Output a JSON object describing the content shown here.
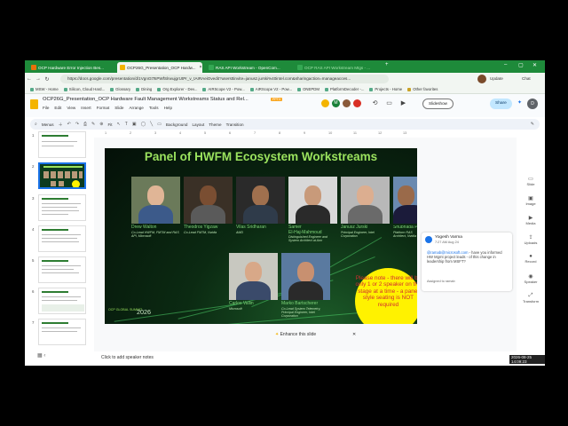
{
  "browser": {
    "tabs": [
      {
        "label": "OCP Hardware Error Injection Bes...",
        "color": "#e8710a"
      },
      {
        "label": "OCP26G_Presentation_OCP Hardw...",
        "color": "#f4b400"
      },
      {
        "label": "RAS API Workstream - OpenCom...",
        "color": "#34a853"
      },
      {
        "label": "OCP RAS API Workstream Mtgs - ...",
        "color": "#34a853"
      }
    ],
    "new_tab": "+",
    "url": "https://docs.google.com/presentation/d/1VgnGtTsPWfSlrwujgrUtPr_v_tAIRAeiOvedit?usersttinvite=janusz.jurski%40intel.com&sharingaction=manageacces...",
    "update_label": "Update",
    "chat_label": "Chat",
    "bookmarks": [
      "MSW - Home",
      "Silicon, Cloud Hard...",
      "Glossary",
      "Dining",
      "Org Explorer - Dev...",
      "AIRScope V2 - Pow...",
      "AIRScope V2 - Pow...",
      "ONEPDM",
      "PlatformDecoder -...",
      "Projects - Home",
      "Other favorites"
    ]
  },
  "docs": {
    "title": "OCP26G_Presentation_OCP Hardware Fault Management Workstreams Status and Rel...",
    "file_badge": "PPTX",
    "menu": [
      "File",
      "Edit",
      "View",
      "Insert",
      "Format",
      "Slide",
      "Arrange",
      "Tools",
      "Help"
    ],
    "slideshow_label": "Slideshow",
    "share_label": "Share",
    "user_initial": "D",
    "avatar_letter": "M"
  },
  "toolbar": {
    "menus_label": "Menus",
    "zoom_label": "Fit",
    "background_label": "Background",
    "layout_label": "Layout",
    "theme_label": "Theme",
    "transition_label": "Transition"
  },
  "ruler": [
    "1",
    "2",
    "3",
    "4",
    "5",
    "6",
    "7",
    "8",
    "9",
    "10",
    "11",
    "12",
    "13"
  ],
  "filmstrip": {
    "numbers": [
      "1",
      "2",
      "3",
      "4",
      "5",
      "6",
      "7"
    ],
    "selected_index": 2
  },
  "slide": {
    "title": "Panel of HWFM Ecosystem Workstreams",
    "people": [
      {
        "name": "Drew Walton",
        "role": "Co-Lead HWFM, FMTM and RAS API, Microsoft",
        "skin": "#e0b596",
        "shirt": "#3c5a8a",
        "bg": "#6b7a5a"
      },
      {
        "name": "Theodros Yigzaw",
        "role": "Co-Lead FMTM, Nvidia",
        "skin": "#7a4e32",
        "shirt": "#5a5a5a",
        "bg": "#3a3026"
      },
      {
        "name": "Vilas Sridharan",
        "role": "AMD",
        "skin": "#a0704e",
        "shirt": "#2f3b4a",
        "bg": "#2a2a2a"
      },
      {
        "name": "Samer\nEl-Haj-Mahmoud",
        "role": "Distinguished Engineer and System Architect at Arm",
        "skin": "#c89a7a",
        "shirt": "#2a2a2a",
        "bg": "#d8d8d8"
      },
      {
        "name": "Janusz Jurski",
        "role": "Principal Engineer, Intel Corporation",
        "skin": "#dcae90",
        "shirt": "#6a6a6a",
        "bg": "#b8b8b8"
      },
      {
        "name": "Shubhada Pugaonkar",
        "role": "Platform RAS Architect, Nvidia",
        "skin": "#9a6a4a",
        "shirt": "#1b1b3a",
        "bg": "#6a8ab0"
      },
      {
        "name": "Carlos Vallin",
        "role": "Microsoft",
        "skin": "#d8a888",
        "shirt": "#3a4a6a",
        "bg": "#c8c8c0"
      },
      {
        "name": "Marko Bartscherer",
        "role": "Co-Lead System Telemetry, Principal Engineer, Intel Corporation",
        "skin": "#c89070",
        "shirt": "#2a2a2a",
        "bg": "#5a7aa0"
      }
    ],
    "note": "Please note - there will be only 1 or 2 speaker on the stage at a time - a panel style seating is NOT required",
    "logo_text": "OCP GLOBAL SUMMIT",
    "year": "2026"
  },
  "enhance_label": "Enhance this slide",
  "enhance_close": "✕",
  "comment": {
    "name": "Yogesh Varma",
    "time": "7:27 AM Aug 24",
    "mention": "@ramab@microsoft.com",
    "body": " - have you informed HW Mgmt project leads - of this change in leadership from MSFT?",
    "assigned": "Assigned to ramab"
  },
  "side_panel": [
    "Slide",
    "Image",
    "Media",
    "Uploads",
    "Record",
    "Speaker",
    "Transform"
  ],
  "speaker_notes_placeholder": "Click to add speaker notes",
  "timestamp": "2026-08-25 14:09:23"
}
